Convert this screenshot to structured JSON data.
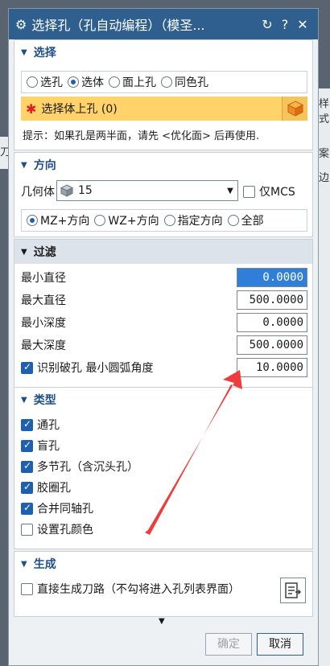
{
  "dialog": {
    "title": "选择孔（孔自动编程）（模圣...",
    "btn_reset": "↻",
    "btn_help": "?",
    "btn_close": "✕"
  },
  "select": {
    "header": "选择",
    "options": [
      "选孔",
      "选体",
      "面上孔",
      "同色孔"
    ],
    "selected_index": 1,
    "select_label": "选择体上孔 (0)",
    "hint": "提示：如果孔是两半面，请先 <优化面> 后再使用."
  },
  "direction": {
    "header": "方向",
    "geometry_label": "几何体",
    "geometry_value": "15",
    "mcs_only_label": "仅MCS",
    "options": [
      "MZ+方向",
      "WZ+方向",
      "指定方向",
      "全部"
    ],
    "selected_index": 0
  },
  "filter": {
    "header": "过滤",
    "min_diameter_label": "最小直径",
    "min_diameter": "0.0000",
    "max_diameter_label": "最大直径",
    "max_diameter": "500.0000",
    "min_depth_label": "最小深度",
    "min_depth": "0.0000",
    "max_depth_label": "最大深度",
    "max_depth": "500.0000",
    "broken_hole_label": "识别破孔 最小圆弧角度",
    "broken_hole_checked": true,
    "min_arc_angle": "10.0000"
  },
  "types": {
    "header": "类型",
    "items": [
      {
        "label": "通孔",
        "checked": true
      },
      {
        "label": "盲孔",
        "checked": true
      },
      {
        "label": "多节孔（含沉头孔）",
        "checked": true
      },
      {
        "label": "胶圈孔",
        "checked": true
      },
      {
        "label": "合并同轴孔",
        "checked": true
      },
      {
        "label": "设置孔颜色",
        "checked": false
      }
    ]
  },
  "generate": {
    "header": "生成",
    "direct_label": "直接生成刀路（不勾将进入孔列表界面）",
    "direct_checked": false
  },
  "footer": {
    "ok_label": "确定",
    "cancel_label": "取消"
  },
  "background": {
    "frag1": "样式",
    "frag2": "案",
    "frag3": "边",
    "frag4": "刀"
  },
  "colors": {
    "titlebar": "#2e5f8e",
    "accent": "#1f5fb0",
    "select_row": "#ffd26a",
    "annotation_arrow": "#ef3b3b"
  }
}
